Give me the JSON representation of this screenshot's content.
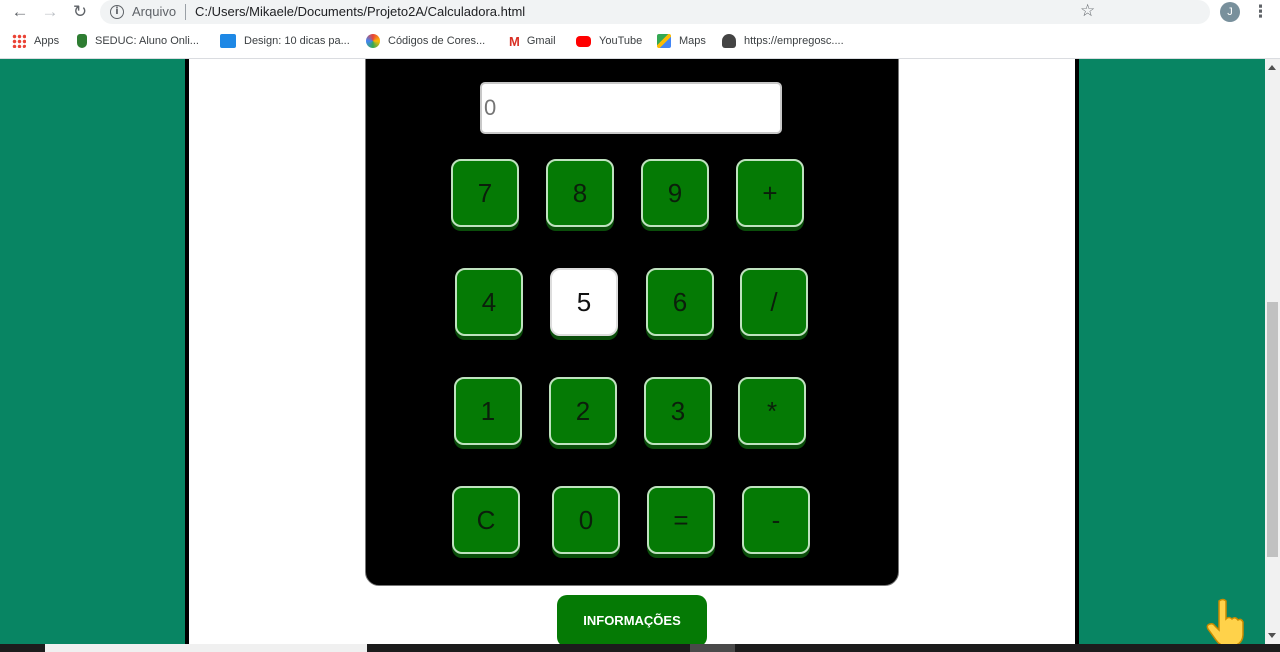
{
  "browser": {
    "url_scheme_label": "Arquivo",
    "url": "C:/Users/Mikaele/Documents/Projeto2A/Calculadora.html",
    "avatar_initial": "J",
    "bookmarks": [
      {
        "label": "Apps",
        "icon": "apps-grid-icon"
      },
      {
        "label": "SEDUC: Aluno Onli...",
        "icon": "seduc-icon"
      },
      {
        "label": "Design: 10 dicas pa...",
        "icon": "design-icon"
      },
      {
        "label": "Códigos de Cores...",
        "icon": "color-wheel-icon"
      },
      {
        "label": "Gmail",
        "icon": "gmail-icon"
      },
      {
        "label": "YouTube",
        "icon": "youtube-icon"
      },
      {
        "label": "Maps",
        "icon": "maps-icon"
      },
      {
        "label": "https://empregosc....",
        "icon": "empregos-icon"
      }
    ]
  },
  "calculator": {
    "display_placeholder": "0",
    "keys": [
      "7",
      "8",
      "9",
      "+",
      "4",
      "5",
      "6",
      "/",
      "1",
      "2",
      "3",
      "*",
      "C",
      "0",
      "=",
      "-"
    ],
    "active_key": "5"
  },
  "info_button_label": "INFORMAÇÕES",
  "colors": {
    "side_panel": "#088563",
    "key_green": "#057a05",
    "calculator_body": "#000000"
  }
}
